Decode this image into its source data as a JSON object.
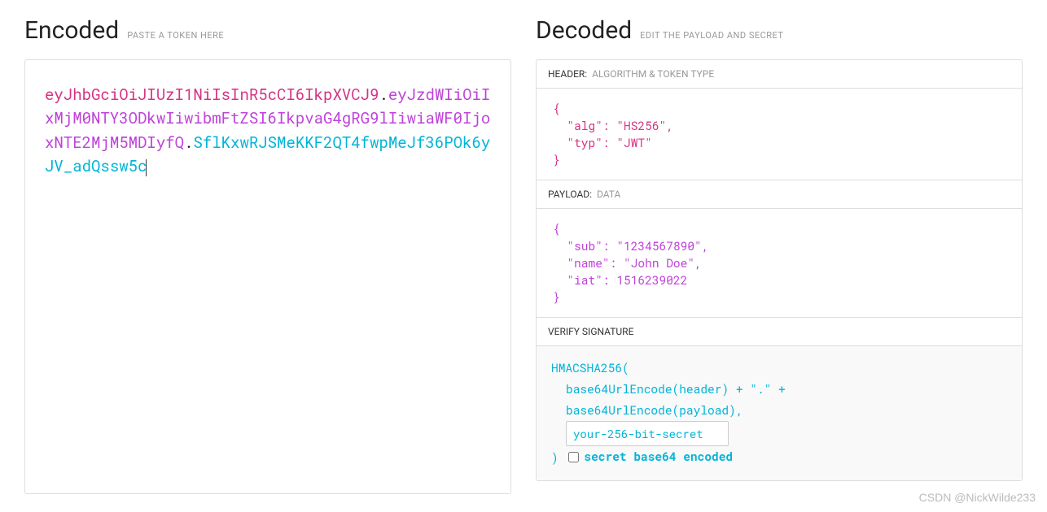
{
  "encoded": {
    "title": "Encoded",
    "subtitle": "PASTE A TOKEN HERE",
    "token_header": "eyJhbGciOiJIUzI1NiIsInR5cCI6IkpXVCJ9",
    "token_payload": "eyJzdWIiOiIxMjM0NTY3ODkwIiwibmFtZSI6IkpvaG4gRG9lIiwiaWF0IjoxNTE2MjM5MDIyfQ",
    "token_signature": "SflKxwRJSMeKKF2QT4fwpMeJf36POk6yJV_adQssw5c",
    "dot": "."
  },
  "decoded": {
    "title": "Decoded",
    "subtitle": "EDIT THE PAYLOAD AND SECRET",
    "header_section": {
      "label": "HEADER:",
      "sublabel": "ALGORITHM & TOKEN TYPE",
      "content": "{\n  \"alg\": \"HS256\",\n  \"typ\": \"JWT\"\n}"
    },
    "payload_section": {
      "label": "PAYLOAD:",
      "sublabel": "DATA",
      "content": "{\n  \"sub\": \"1234567890\",\n  \"name\": \"John Doe\",\n  \"iat\": 1516239022\n}"
    },
    "signature_section": {
      "label": "VERIFY SIGNATURE",
      "fn_name": "HMACSHA256(",
      "line1": "base64UrlEncode(header) + \".\" +",
      "line2": "base64UrlEncode(payload),",
      "secret_value": "your-256-bit-secret",
      "close_paren": ")",
      "checkbox_label": "secret base64 encoded"
    }
  },
  "watermark": "CSDN @NickWilde233"
}
